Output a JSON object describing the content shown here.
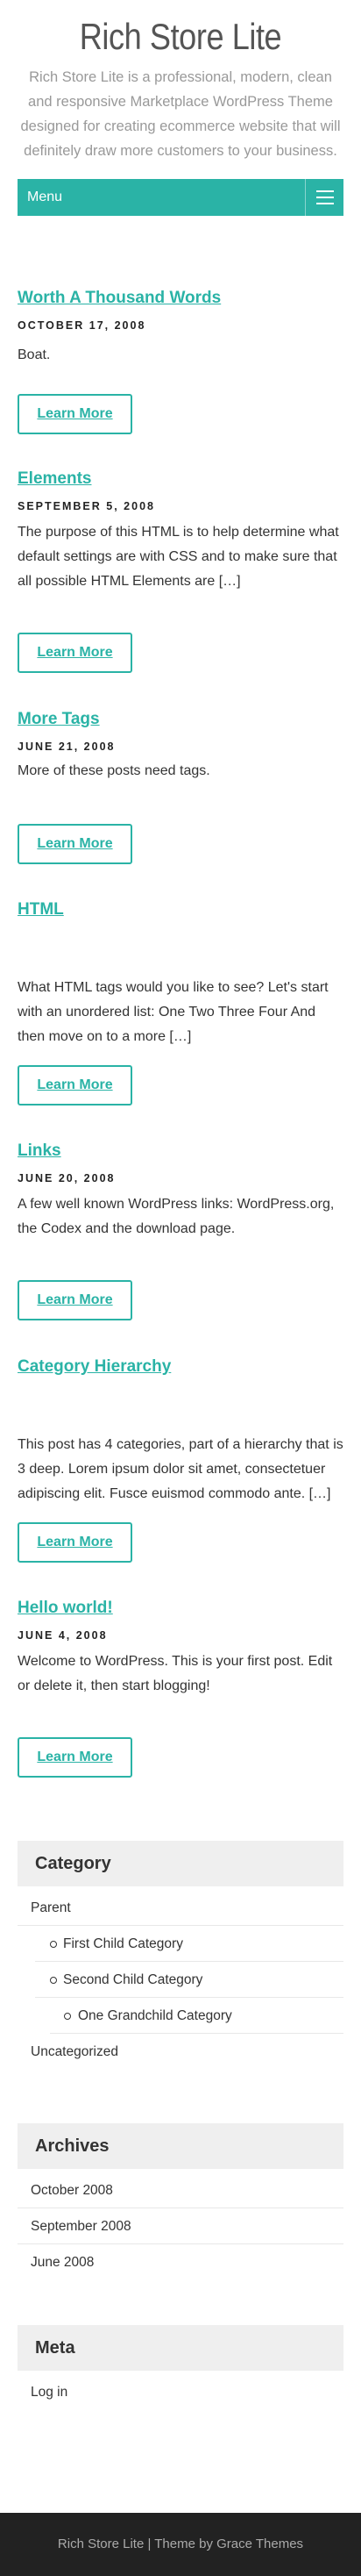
{
  "header": {
    "title": "Rich Store Lite",
    "description": "Rich Store Lite is a professional, modern, clean and responsive Marketplace WordPress Theme designed for creating ecommerce website that will definitely draw more customers to your business."
  },
  "menu": {
    "label": "Menu"
  },
  "posts": [
    {
      "title": "Worth A Thousand Words",
      "date": "October 17, 2008",
      "excerpt": "Boat.",
      "button": "Learn More"
    },
    {
      "title": "Elements",
      "date": "September 5, 2008",
      "excerpt": "The purpose of this HTML is to help determine what default settings are with CSS and to make sure that all possible HTML Elements are […]",
      "button": "Learn More"
    },
    {
      "title": "More Tags",
      "date": "June 21, 2008",
      "excerpt": "More of these posts need tags.",
      "button": "Learn More"
    },
    {
      "title": "HTML",
      "date": "",
      "excerpt": "What HTML tags would you like to see? Let's start with an unordered list: One Two Three Four And then move on to a more […]",
      "button": "Learn More"
    },
    {
      "title": "Links",
      "date": "June 20, 2008",
      "excerpt": "A few well known WordPress links: WordPress.org, the Codex and the download page.",
      "button": "Learn More"
    },
    {
      "title": "Category Hierarchy",
      "date": "",
      "excerpt": "This post has 4 categories, part of a hierarchy that is 3 deep. Lorem ipsum dolor sit amet, consectetuer adipiscing elit. Fusce euismod commodo ante. […]",
      "button": "Learn More"
    },
    {
      "title": "Hello world!",
      "date": "June 4, 2008",
      "excerpt": "Welcome to WordPress. This is your first post. Edit or delete it, then start blogging!",
      "button": "Learn More"
    }
  ],
  "widgets": {
    "category": {
      "title": "Category",
      "parent": "Parent",
      "first_child": "First Child Category",
      "second_child": "Second Child Category",
      "grandchild": "One Grandchild Category",
      "uncategorized": "Uncategorized"
    },
    "archives": {
      "title": "Archives",
      "items": [
        "October 2008",
        "September 2008",
        "June 2008"
      ]
    },
    "meta": {
      "title": "Meta",
      "login": "Log in"
    }
  },
  "footer": {
    "text": "Rich Store Lite | Theme by Grace Themes"
  },
  "colors": {
    "accent": "#2ab3a6",
    "footer_bg": "#222222",
    "widget_title_bg": "#efefef"
  }
}
